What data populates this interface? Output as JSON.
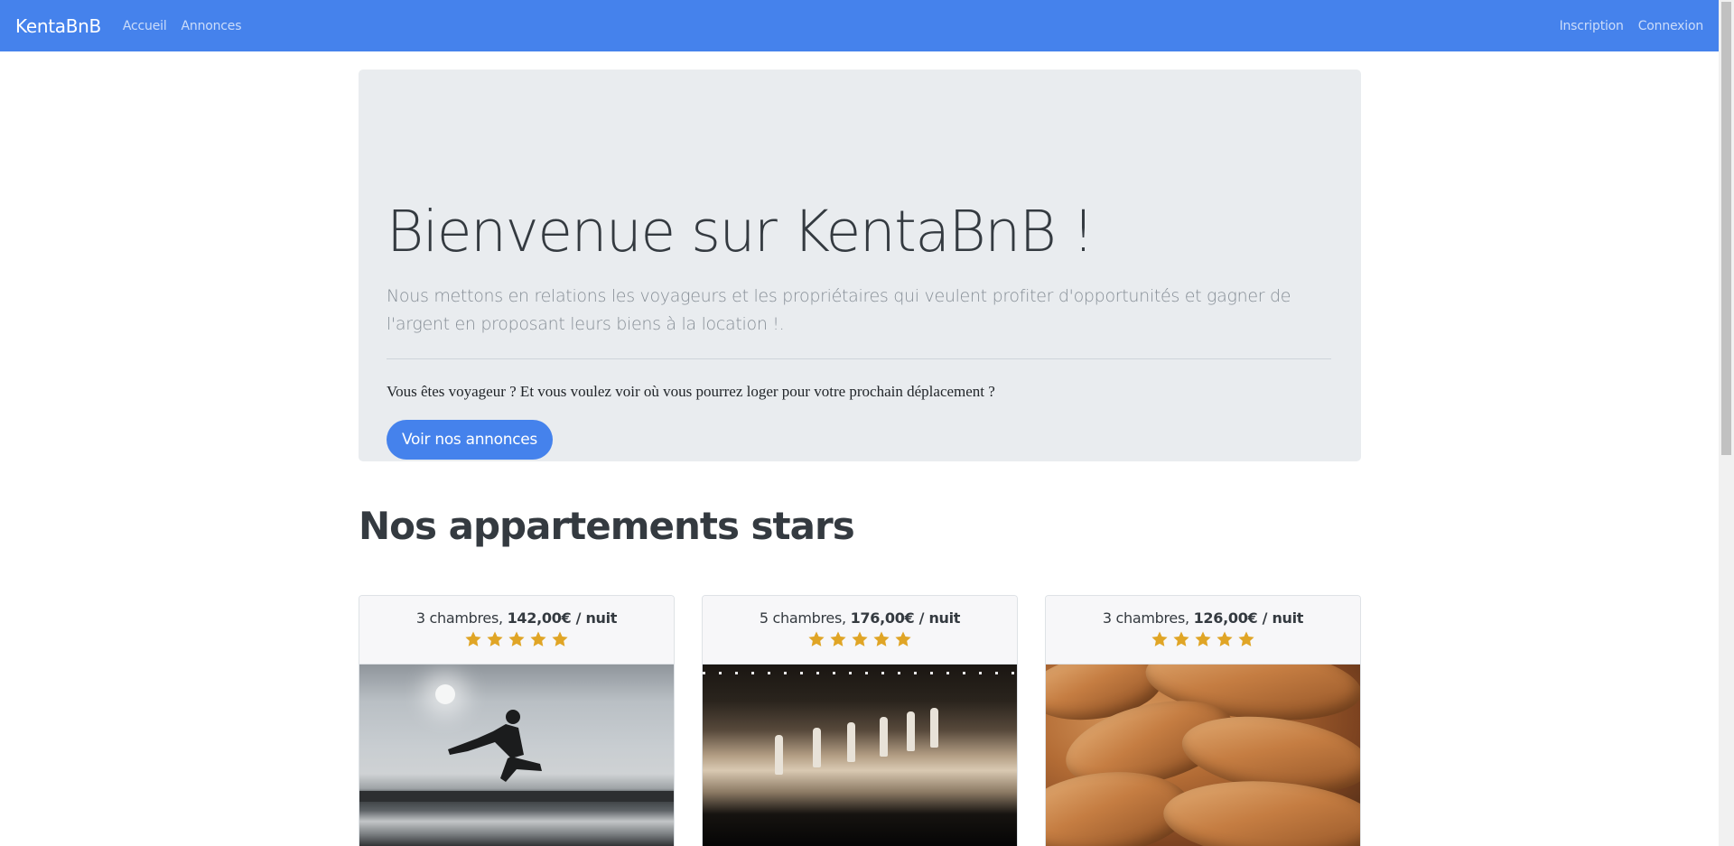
{
  "navbar": {
    "brand": "KentaBnB",
    "links": [
      "Accueil",
      "Annonces"
    ],
    "right_links": [
      "Inscription",
      "Connexion"
    ],
    "background_color": "#4582ec"
  },
  "jumbotron": {
    "title": "Bienvenue sur KentaBnB !",
    "lead": "Nous mettons en relations les voyageurs et les propriétaires qui veulent profiter d'opportunités et gagner de l'argent en proposant leurs biens à la location !.",
    "question": "Vous êtes voyageur ? Et vous voulez voir où vous pourrez loger pour votre prochain déplacement ?",
    "button_label": "Voir nos annonces"
  },
  "section": {
    "title": "Nos appartements stars"
  },
  "cards": [
    {
      "rooms": "3 chambres,",
      "price": "142,00€ / nuit",
      "rating": 5,
      "image": "silhouette-jump-photo"
    },
    {
      "rooms": "5 chambres,",
      "price": "176,00€ / nuit",
      "rating": 5,
      "image": "fashion-runway-photo"
    },
    {
      "rooms": "3 chambres,",
      "price": "126,00€ / nuit",
      "rating": 5,
      "image": "bread-loaves-photo"
    }
  ],
  "colors": {
    "primary": "#4582ec",
    "star": "#e0a526",
    "jumbotron_bg": "#e9ecef"
  }
}
